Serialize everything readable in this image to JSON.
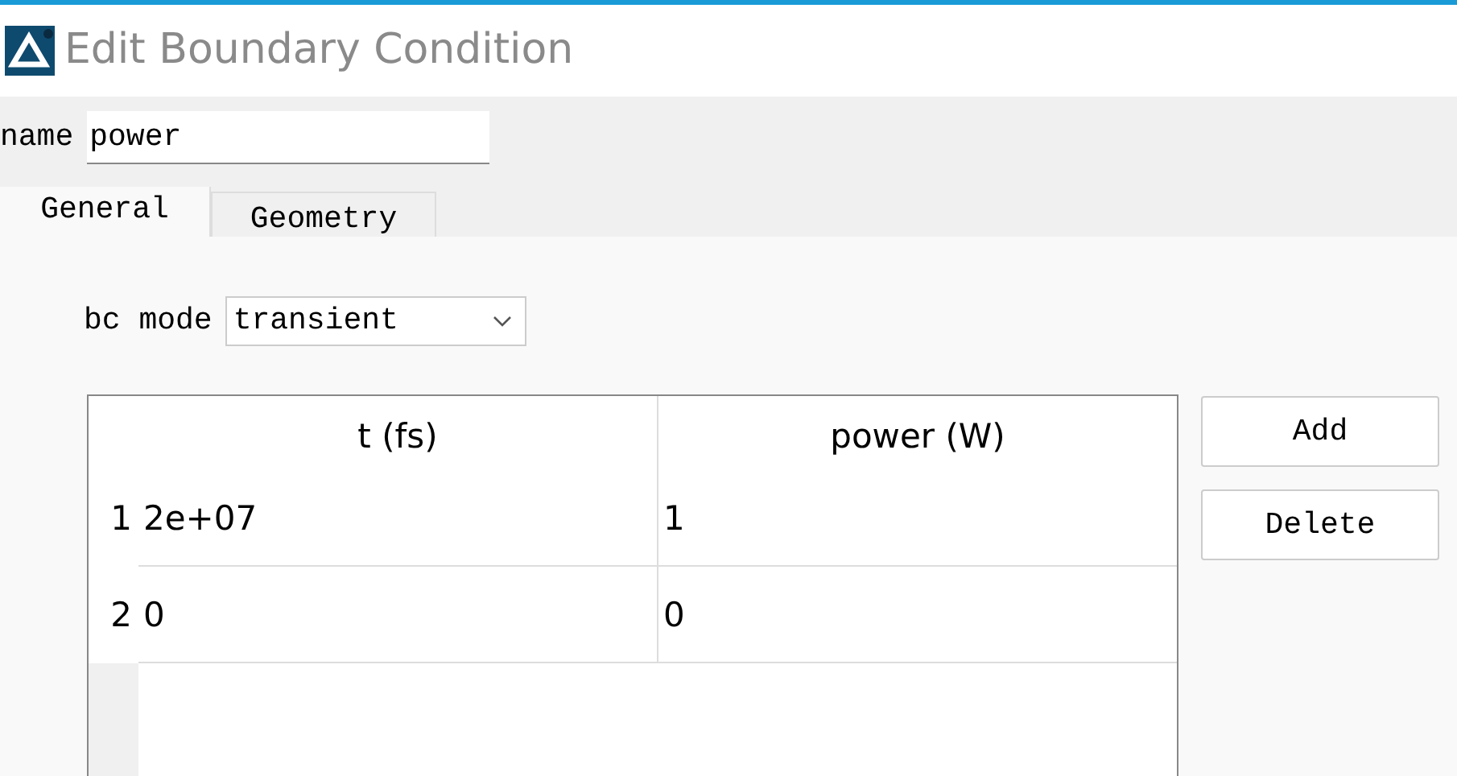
{
  "window": {
    "title": "Edit Boundary Condition"
  },
  "name_field": {
    "label": "name",
    "value": "power"
  },
  "tabs": [
    {
      "label": "General",
      "selected": true
    },
    {
      "label": "Geometry",
      "selected": false
    }
  ],
  "bc_mode": {
    "label": "bc mode",
    "value": "transient"
  },
  "table": {
    "columns": [
      "t (fs)",
      "power (W)"
    ],
    "rows": [
      {
        "number": "1",
        "cells": [
          "2e+07",
          "1"
        ]
      },
      {
        "number": "2",
        "cells": [
          "0",
          "0"
        ]
      }
    ]
  },
  "buttons": [
    "Add",
    "Delete"
  ]
}
